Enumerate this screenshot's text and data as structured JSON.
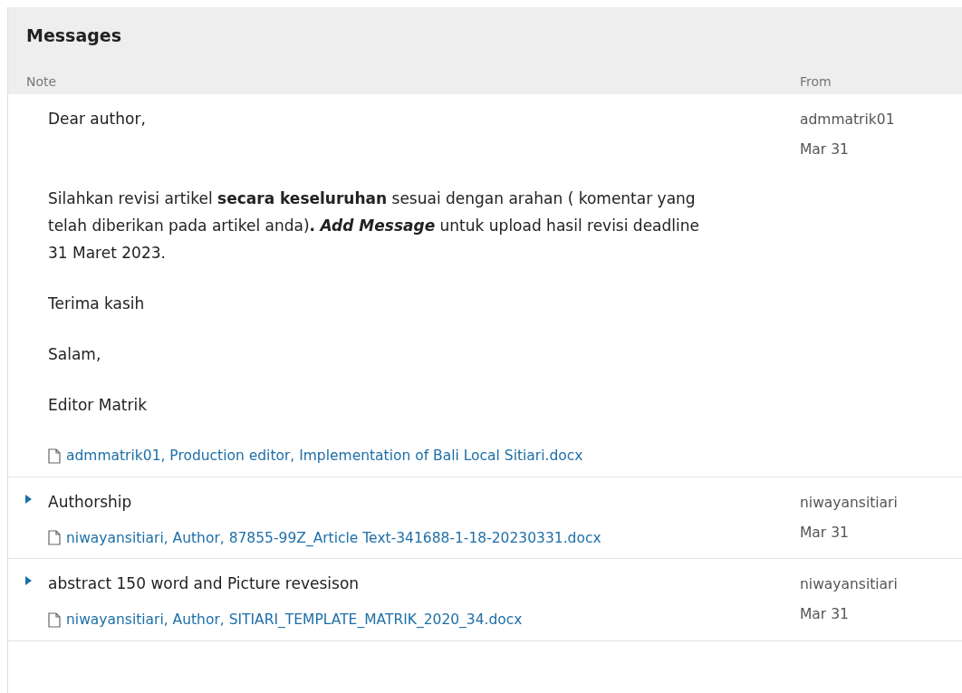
{
  "panel": {
    "title": "Messages"
  },
  "columns": [
    "Note",
    "From"
  ],
  "messages": [
    {
      "expanded": true,
      "paragraphs": [
        "Dear author,",
        "Silahkan revisi artikel **secara keseluruhan** sesuai  dengan arahan ( komentar yang telah diberikan pada artikel anda)**.** *Add Message* untuk upload hasil revisi deadline 31 Maret 2023.",
        "Terima kasih",
        "Salam,",
        "Editor Matrik"
      ],
      "file": "admmatrik01, Production editor, Implementation of Bali Local Sitiari.docx",
      "from": "admmatrik01",
      "date": "Mar 31"
    },
    {
      "expanded": false,
      "paragraphs": [
        "Authorship"
      ],
      "file": "niwayansitiari, Author, 87855-99Z_Article Text-341688-1-18-20230331.docx",
      "from": "niwayansitiari",
      "date": "Mar 31"
    },
    {
      "expanded": false,
      "paragraphs": [
        "abstract 150 word and Picture revesison"
      ],
      "file": "niwayansitiari, Author, SITIARI_TEMPLATE_MATRIK_2020_34.docx",
      "from": "niwayansitiari",
      "date": "Mar 31"
    }
  ]
}
